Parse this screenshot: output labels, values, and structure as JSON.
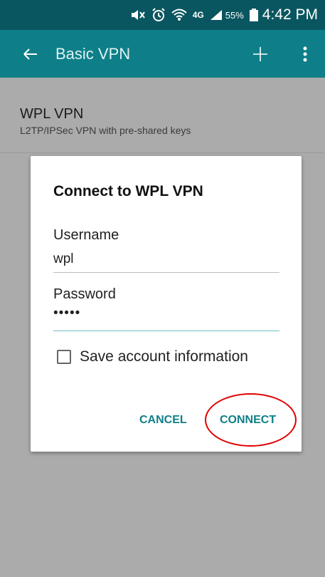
{
  "status_bar": {
    "battery": "55%",
    "time": "4:42 PM",
    "network": "4G"
  },
  "app_bar": {
    "title": "Basic VPN",
    "back_icon": "arrow-back-icon",
    "add_icon": "plus-icon",
    "more_icon": "more-vert-icon"
  },
  "vpn_list": [
    {
      "name": "WPL VPN",
      "description": "L2TP/IPSec VPN with pre-shared keys"
    }
  ],
  "dialog": {
    "title": "Connect to WPL VPN",
    "username_label": "Username",
    "username_value": "wpl",
    "password_label": "Password",
    "password_value": "•••••",
    "save_label": "Save account information",
    "save_checked": false,
    "cancel_label": "CANCEL",
    "connect_label": "CONNECT"
  },
  "colors": {
    "status_bar": "#0a5660",
    "app_bar": "#0e7f88",
    "accent": "#0e7f88",
    "annotation": "#e00000"
  }
}
